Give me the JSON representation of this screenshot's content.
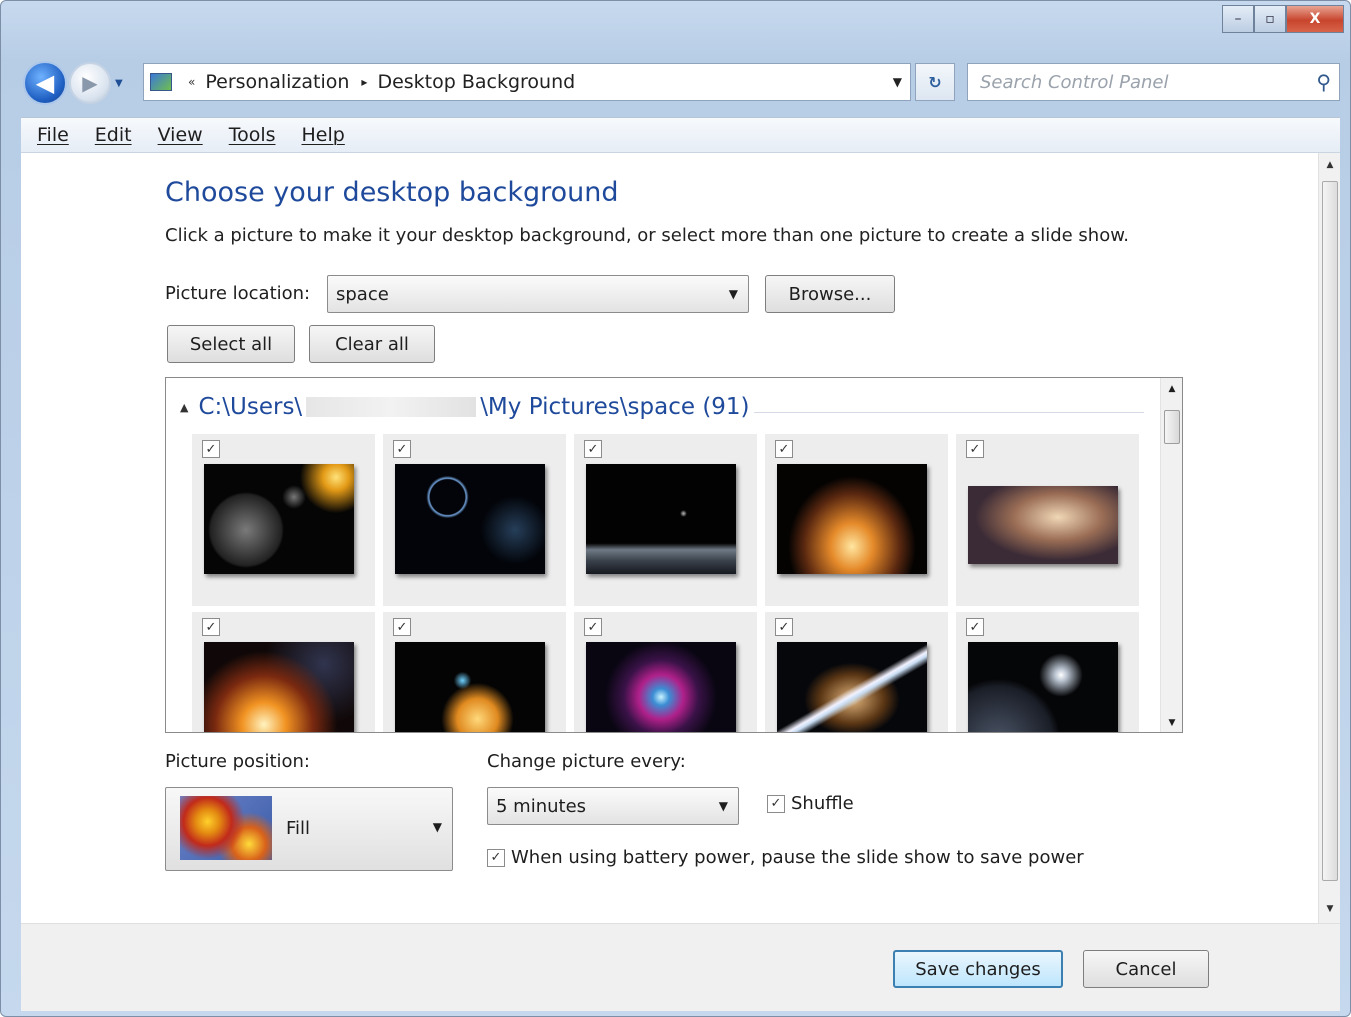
{
  "window": {
    "caption_buttons": {
      "minimize": "–",
      "maximize": "▫",
      "close": "X"
    }
  },
  "nav": {
    "back_icon": "◀",
    "forward_icon": "▶",
    "address": {
      "chevron": "«",
      "crumb1": "Personalization",
      "separator": "▸",
      "crumb2": "Desktop Background",
      "dropdown": "▼"
    },
    "refresh_icon": "↻",
    "search_placeholder": "Search Control Panel",
    "search_icon": "⚲"
  },
  "menu": [
    "File",
    "Edit",
    "View",
    "Tools",
    "Help"
  ],
  "page": {
    "title": "Choose your desktop background",
    "description": "Click a picture to make it your desktop background, or select more than one picture to create a slide show.",
    "location_label": "Picture location:",
    "location_value": "space",
    "browse": "Browse...",
    "select_all": "Select all",
    "clear_all": "Clear all",
    "group_prefix": "C:\\Users\\",
    "group_suffix": "\\My Pictures\\space (91)",
    "tiles_checked": "✓",
    "position_label": "Picture position:",
    "position_value": "Fill",
    "change_label": "Change picture every:",
    "change_value": "5 minutes",
    "shuffle_label": "Shuffle",
    "battery_label": "When using battery power, pause the slide show to save power",
    "dropdown_icon": "▼",
    "scroll_up": "▲",
    "scroll_down": "▼"
  },
  "footer": {
    "save": "Save changes",
    "cancel": "Cancel"
  }
}
